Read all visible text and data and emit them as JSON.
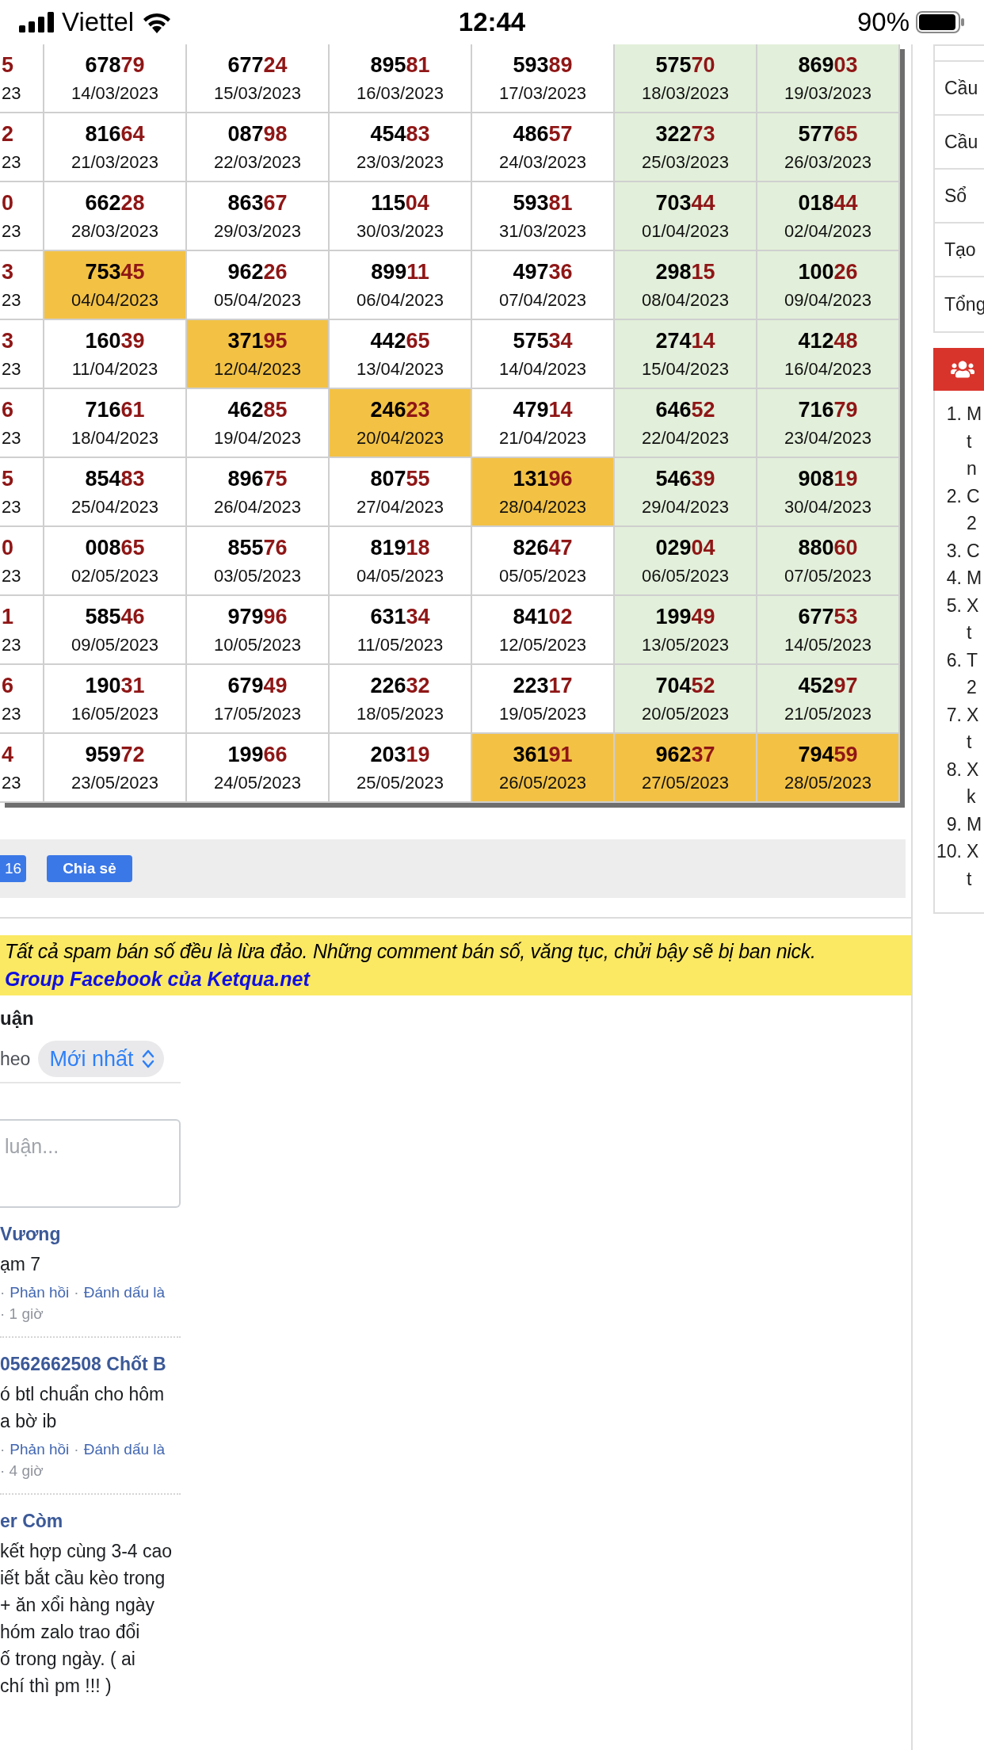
{
  "status_bar": {
    "carrier": "Viettel",
    "time": "12:44",
    "battery": "90%"
  },
  "results_table": {
    "rows": [
      {
        "cells": [
          {
            "tail": "5",
            "date": "23",
            "kind": "plain"
          },
          {
            "head": "678",
            "tail": "79",
            "date": "14/03/2023",
            "kind": "plain"
          },
          {
            "head": "677",
            "tail": "24",
            "date": "15/03/2023",
            "kind": "plain"
          },
          {
            "head": "895",
            "tail": "81",
            "date": "16/03/2023",
            "kind": "plain"
          },
          {
            "head": "593",
            "tail": "89",
            "date": "17/03/2023",
            "kind": "plain"
          },
          {
            "head": "575",
            "tail": "70",
            "date": "18/03/2023",
            "kind": "weekend"
          },
          {
            "head": "869",
            "tail": "03",
            "date": "19/03/2023",
            "kind": "weekend"
          }
        ]
      },
      {
        "cells": [
          {
            "tail": "2",
            "date": "23",
            "kind": "plain"
          },
          {
            "head": "816",
            "tail": "64",
            "date": "21/03/2023",
            "kind": "plain"
          },
          {
            "head": "087",
            "tail": "98",
            "date": "22/03/2023",
            "kind": "plain"
          },
          {
            "head": "454",
            "tail": "83",
            "date": "23/03/2023",
            "kind": "plain"
          },
          {
            "head": "486",
            "tail": "57",
            "date": "24/03/2023",
            "kind": "plain"
          },
          {
            "head": "322",
            "tail": "73",
            "date": "25/03/2023",
            "kind": "weekend"
          },
          {
            "head": "577",
            "tail": "65",
            "date": "26/03/2023",
            "kind": "weekend"
          }
        ]
      },
      {
        "cells": [
          {
            "tail": "0",
            "date": "23",
            "kind": "plain"
          },
          {
            "head": "662",
            "tail": "28",
            "date": "28/03/2023",
            "kind": "plain"
          },
          {
            "head": "863",
            "tail": "67",
            "date": "29/03/2023",
            "kind": "plain"
          },
          {
            "head": "115",
            "tail": "04",
            "date": "30/03/2023",
            "kind": "plain"
          },
          {
            "head": "593",
            "tail": "81",
            "date": "31/03/2023",
            "kind": "plain"
          },
          {
            "head": "703",
            "tail": "44",
            "date": "01/04/2023",
            "kind": "weekend"
          },
          {
            "head": "018",
            "tail": "44",
            "date": "02/04/2023",
            "kind": "weekend"
          }
        ]
      },
      {
        "cells": [
          {
            "tail": "3",
            "date": "23",
            "kind": "plain"
          },
          {
            "head": "753",
            "tail": "45",
            "date": "04/04/2023",
            "kind": "highlight"
          },
          {
            "head": "962",
            "tail": "26",
            "date": "05/04/2023",
            "kind": "plain"
          },
          {
            "head": "899",
            "tail": "11",
            "date": "06/04/2023",
            "kind": "plain"
          },
          {
            "head": "497",
            "tail": "36",
            "date": "07/04/2023",
            "kind": "plain"
          },
          {
            "head": "298",
            "tail": "15",
            "date": "08/04/2023",
            "kind": "weekend"
          },
          {
            "head": "100",
            "tail": "26",
            "date": "09/04/2023",
            "kind": "weekend"
          }
        ]
      },
      {
        "cells": [
          {
            "tail": "3",
            "date": "23",
            "kind": "plain"
          },
          {
            "head": "160",
            "tail": "39",
            "date": "11/04/2023",
            "kind": "plain"
          },
          {
            "head": "371",
            "tail": "95",
            "date": "12/04/2023",
            "kind": "highlight"
          },
          {
            "head": "442",
            "tail": "65",
            "date": "13/04/2023",
            "kind": "plain"
          },
          {
            "head": "575",
            "tail": "34",
            "date": "14/04/2023",
            "kind": "plain"
          },
          {
            "head": "274",
            "tail": "14",
            "date": "15/04/2023",
            "kind": "weekend"
          },
          {
            "head": "412",
            "tail": "48",
            "date": "16/04/2023",
            "kind": "weekend"
          }
        ]
      },
      {
        "cells": [
          {
            "tail": "6",
            "date": "23",
            "kind": "plain"
          },
          {
            "head": "716",
            "tail": "61",
            "date": "18/04/2023",
            "kind": "plain"
          },
          {
            "head": "462",
            "tail": "85",
            "date": "19/04/2023",
            "kind": "plain"
          },
          {
            "head": "246",
            "tail": "23",
            "date": "20/04/2023",
            "kind": "highlight"
          },
          {
            "head": "479",
            "tail": "14",
            "date": "21/04/2023",
            "kind": "plain"
          },
          {
            "head": "646",
            "tail": "52",
            "date": "22/04/2023",
            "kind": "weekend"
          },
          {
            "head": "716",
            "tail": "79",
            "date": "23/04/2023",
            "kind": "weekend"
          }
        ]
      },
      {
        "cells": [
          {
            "tail": "5",
            "date": "23",
            "kind": "plain"
          },
          {
            "head": "854",
            "tail": "83",
            "date": "25/04/2023",
            "kind": "plain"
          },
          {
            "head": "896",
            "tail": "75",
            "date": "26/04/2023",
            "kind": "plain"
          },
          {
            "head": "807",
            "tail": "55",
            "date": "27/04/2023",
            "kind": "plain"
          },
          {
            "head": "131",
            "tail": "96",
            "date": "28/04/2023",
            "kind": "highlight"
          },
          {
            "head": "546",
            "tail": "39",
            "date": "29/04/2023",
            "kind": "weekend"
          },
          {
            "head": "908",
            "tail": "19",
            "date": "30/04/2023",
            "kind": "weekend"
          }
        ]
      },
      {
        "cells": [
          {
            "tail": "0",
            "date": "23",
            "kind": "plain"
          },
          {
            "head": "008",
            "tail": "65",
            "date": "02/05/2023",
            "kind": "plain"
          },
          {
            "head": "855",
            "tail": "76",
            "date": "03/05/2023",
            "kind": "plain"
          },
          {
            "head": "819",
            "tail": "18",
            "date": "04/05/2023",
            "kind": "plain"
          },
          {
            "head": "826",
            "tail": "47",
            "date": "05/05/2023",
            "kind": "plain"
          },
          {
            "head": "029",
            "tail": "04",
            "date": "06/05/2023",
            "kind": "weekend"
          },
          {
            "head": "880",
            "tail": "60",
            "date": "07/05/2023",
            "kind": "weekend"
          }
        ]
      },
      {
        "cells": [
          {
            "tail": "1",
            "date": "23",
            "kind": "plain"
          },
          {
            "head": "585",
            "tail": "46",
            "date": "09/05/2023",
            "kind": "plain"
          },
          {
            "head": "979",
            "tail": "96",
            "date": "10/05/2023",
            "kind": "plain"
          },
          {
            "head": "631",
            "tail": "34",
            "date": "11/05/2023",
            "kind": "plain"
          },
          {
            "head": "841",
            "tail": "02",
            "date": "12/05/2023",
            "kind": "plain"
          },
          {
            "head": "199",
            "tail": "49",
            "date": "13/05/2023",
            "kind": "weekend"
          },
          {
            "head": "677",
            "tail": "53",
            "date": "14/05/2023",
            "kind": "weekend"
          }
        ]
      },
      {
        "cells": [
          {
            "tail": "6",
            "date": "23",
            "kind": "plain"
          },
          {
            "head": "190",
            "tail": "31",
            "date": "16/05/2023",
            "kind": "plain"
          },
          {
            "head": "679",
            "tail": "49",
            "date": "17/05/2023",
            "kind": "plain"
          },
          {
            "head": "226",
            "tail": "32",
            "date": "18/05/2023",
            "kind": "plain"
          },
          {
            "head": "223",
            "tail": "17",
            "date": "19/05/2023",
            "kind": "plain"
          },
          {
            "head": "704",
            "tail": "52",
            "date": "20/05/2023",
            "kind": "weekend"
          },
          {
            "head": "452",
            "tail": "97",
            "date": "21/05/2023",
            "kind": "weekend"
          }
        ]
      },
      {
        "cells": [
          {
            "tail": "4",
            "date": "23",
            "kind": "plain"
          },
          {
            "head": "959",
            "tail": "72",
            "date": "23/05/2023",
            "kind": "plain"
          },
          {
            "head": "199",
            "tail": "66",
            "date": "24/05/2023",
            "kind": "plain"
          },
          {
            "head": "203",
            "tail": "19",
            "date": "25/05/2023",
            "kind": "plain"
          },
          {
            "head": "361",
            "tail": "91",
            "date": "26/05/2023",
            "kind": "highlight"
          },
          {
            "head": "962",
            "tail": "37",
            "date": "27/05/2023",
            "kind": "highlight"
          },
          {
            "head": "794",
            "tail": "59",
            "date": "28/05/2023",
            "kind": "highlight"
          }
        ]
      }
    ]
  },
  "share_bar": {
    "buttons": [
      "16",
      "Chia sẻ"
    ]
  },
  "notice": {
    "text": "Tất cả spam bán số đều là lừa đảo. Những comment bán số, văng tục, chửi bậy sẽ bị ban nick.",
    "link": "Group Facebook của Ketqua.net"
  },
  "comments": {
    "title": "uận",
    "sort_label": "heo",
    "sort_value": "Mới nhất",
    "input_placeholder": "luận...",
    "items": [
      {
        "author": "Vương",
        "lines": [
          "ạm 7"
        ],
        "actions": [
          {
            "kind": "sep",
            "text": "·"
          },
          {
            "kind": "link",
            "text": "Phản hồi"
          },
          {
            "kind": "sep",
            "text": "·"
          },
          {
            "kind": "link",
            "text": "Đánh dấu là"
          }
        ],
        "time": "· 1 giờ"
      },
      {
        "author": "0562662508 Chốt B",
        "lines": [
          "ó btl chuẩn cho hôm",
          "a bờ ib"
        ],
        "actions": [
          {
            "kind": "sep",
            "text": "·"
          },
          {
            "kind": "link",
            "text": "Phản hồi"
          },
          {
            "kind": "sep",
            "text": "·"
          },
          {
            "kind": "link",
            "text": "Đánh dấu là"
          }
        ],
        "time": "· 4 giờ"
      },
      {
        "author": "er Còm",
        "lines": [
          "kết hợp cùng 3-4 cao",
          "iết bắt cầu kèo trong",
          "+ ăn xổi hàng ngày",
          "hóm zalo trao đổi",
          "ố trong ngày. ( ai",
          "chí thì pm !!! )"
        ]
      }
    ]
  },
  "sidebar": {
    "links": [
      "Cầu",
      "Cầu",
      "Sổ",
      "Tạo",
      "Tổng"
    ],
    "panel": {
      "items": [
        {
          "number": "1.",
          "lines": [
            "M",
            "t",
            "n"
          ]
        },
        {
          "number": "2.",
          "lines": [
            "C",
            "2"
          ]
        },
        {
          "number": "3.",
          "lines": [
            "C"
          ]
        },
        {
          "number": "4.",
          "lines": [
            "M"
          ]
        },
        {
          "number": "5.",
          "lines": [
            "X",
            "t"
          ]
        },
        {
          "number": "6.",
          "lines": [
            "T",
            "2"
          ]
        },
        {
          "number": "7.",
          "lines": [
            "X",
            "t"
          ]
        },
        {
          "number": "8.",
          "lines": [
            "X",
            "k"
          ]
        },
        {
          "number": "9.",
          "lines": [
            "M"
          ]
        },
        {
          "number": "10.",
          "lines": [
            "X",
            "t"
          ]
        }
      ]
    }
  }
}
